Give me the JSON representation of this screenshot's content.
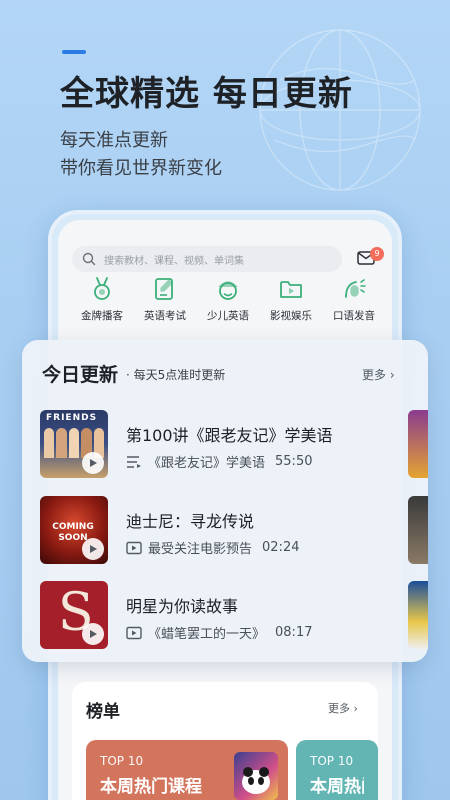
{
  "hero": {
    "title": "全球精选 每日更新",
    "subtitle_1": "每天准点更新",
    "subtitle_2": "带你看见世界新变化"
  },
  "app": {
    "search_placeholder": "搜索教材、课程、视频、单词集",
    "message_badge": "9",
    "categories": [
      {
        "label": "金牌播客",
        "icon": "medal-icon"
      },
      {
        "label": "英语考试",
        "icon": "exam-pencil-icon"
      },
      {
        "label": "少儿英语",
        "icon": "kid-face-icon"
      },
      {
        "label": "影视娱乐",
        "icon": "video-folder-icon"
      },
      {
        "label": "口语发音",
        "icon": "speaking-mic-icon"
      }
    ]
  },
  "today": {
    "title": "今日更新",
    "subtitle": "· 每天5点准时更新",
    "more": "更多 ›",
    "items": [
      {
        "title": "第100讲《跟老友记》学美语",
        "meta_icon": "list-icon",
        "meta": "《跟老友记》学美语",
        "duration": "55:50",
        "thumb_text": "FRIENDS"
      },
      {
        "title": "迪士尼：寻龙传说",
        "meta_icon": "video-icon",
        "meta": "最受关注电影预告",
        "duration": "02:24",
        "thumb_text": "COMING SOON"
      },
      {
        "title": "明星为你读故事",
        "meta_icon": "video-icon",
        "meta": "《蜡笔罢工的一天》",
        "duration": "08:17",
        "thumb_text": "S"
      }
    ]
  },
  "ranking": {
    "title": "榜单",
    "more": "更多 ›",
    "tiles": [
      {
        "top": "TOP 10",
        "name": "本周热门课程"
      },
      {
        "top": "TOP 10",
        "name": "本周热门"
      }
    ]
  },
  "colors": {
    "accent": "#2c7be5",
    "badge": "#f26d5b",
    "icon_green": "#3bb07a",
    "tile_1": "#d3745d",
    "tile_2": "#63b5b4"
  }
}
